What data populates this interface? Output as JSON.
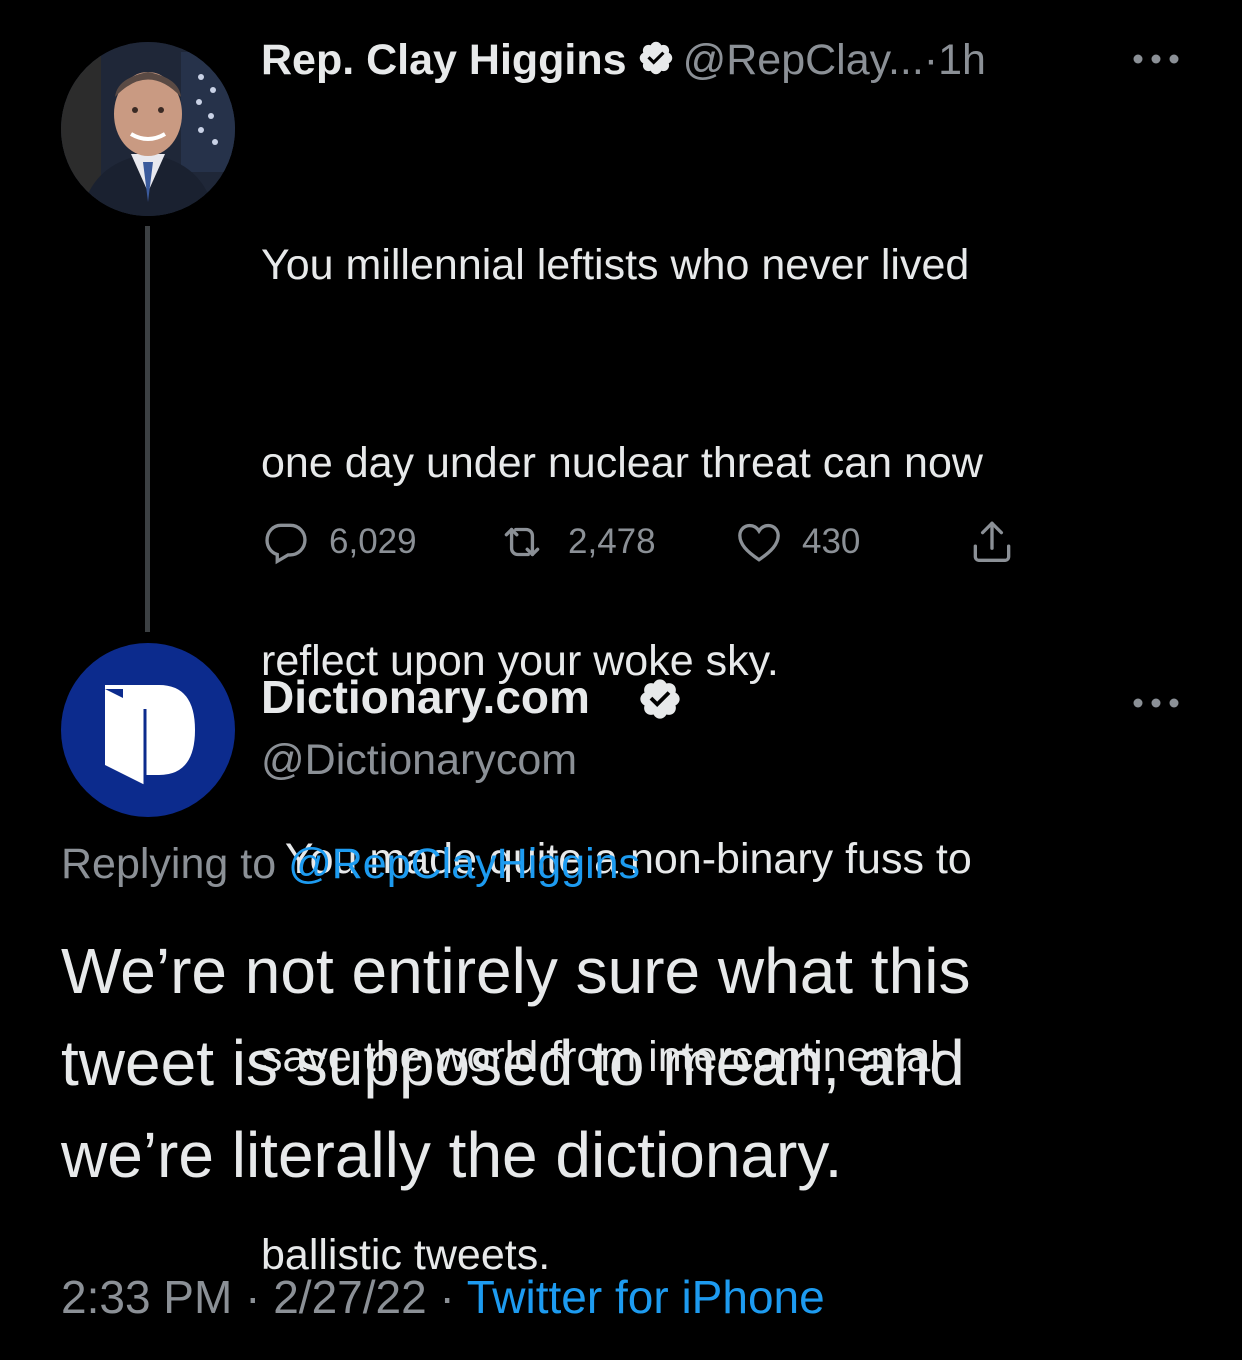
{
  "tweet1": {
    "display_name": "Rep. Clay Higgins",
    "handle": "@RepClay...",
    "separator": "·",
    "time_ago": "1h",
    "more_icon": "more-horizontal-icon",
    "text_lines": [
      "You millennial leftists who never lived",
      "one day under nuclear threat can now",
      "reflect upon your woke sky.",
      "  You made quite a non-binary fuss to",
      "save the world from intercontinental",
      "ballistic tweets."
    ],
    "actions": {
      "replies": "6,029",
      "retweets": "2,478",
      "likes": "430"
    }
  },
  "tweet2": {
    "display_name": "Dictionary.com",
    "handle": "@Dictionarycom",
    "more_icon": "more-horizontal-icon",
    "replying_prefix": "Replying to",
    "replying_mention": "@RepClayHiggins",
    "text_lines": [
      "We’re not entirely sure what this",
      "tweet is supposed to mean, and",
      "we’re literally the dictionary."
    ],
    "time": "2:33 PM",
    "separator": "·",
    "date": "2/27/22",
    "source": "Twitter for iPhone"
  },
  "colors": {
    "background": "#000000",
    "text": "#e7e9ea",
    "secondary": "#8b9096",
    "link": "#1d9bf0",
    "dictionary_blue": "#0c2b8d"
  }
}
